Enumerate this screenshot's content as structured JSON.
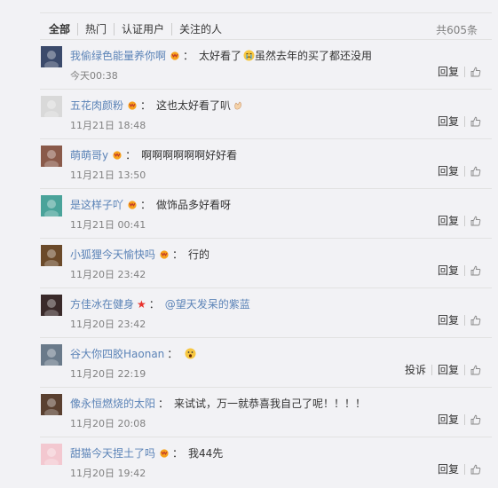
{
  "tabs": [
    {
      "label": "全部"
    },
    {
      "label": "热门"
    },
    {
      "label": "认证用户"
    },
    {
      "label": "关注的人"
    }
  ],
  "total_count": "共605条",
  "comments": [
    {
      "user": "我偷绿色能量养你啊",
      "vip": true,
      "star": false,
      "text": "太好看了",
      "emoji": "crying-face",
      "text2": "虽然去年的买了都还没用",
      "mention": "",
      "time": "今天00:38",
      "report": "",
      "reply": "回复",
      "avatar_color": "#3b4a6b"
    },
    {
      "user": "五花肉颜粉",
      "vip": true,
      "star": false,
      "text": "这也太好看了叭",
      "emoji": "clapping-hands",
      "text2": "",
      "mention": "",
      "time": "11月21日 18:48",
      "report": "",
      "reply": "回复",
      "avatar_color": "#d9d9d9"
    },
    {
      "user": "萌萌哥y",
      "vip": true,
      "star": false,
      "text": "啊啊啊啊啊啊好好看",
      "emoji": "",
      "text2": "",
      "mention": "",
      "time": "11月21日 13:50",
      "report": "",
      "reply": "回复",
      "avatar_color": "#8a5a4a"
    },
    {
      "user": "是这样子吖",
      "vip": true,
      "star": false,
      "text": "做饰品多好看呀",
      "emoji": "",
      "text2": "",
      "mention": "",
      "time": "11月21日 00:41",
      "report": "",
      "reply": "回复",
      "avatar_color": "#4aa39a"
    },
    {
      "user": "小狐狸今天愉快吗",
      "vip": true,
      "star": false,
      "text": "行的",
      "emoji": "",
      "text2": "",
      "mention": "",
      "time": "11月20日 23:42",
      "report": "",
      "reply": "回复",
      "avatar_color": "#6b4a2a"
    },
    {
      "user": "方佳冰在健身",
      "vip": false,
      "star": true,
      "text": "",
      "emoji": "",
      "text2": "",
      "mention": "@望天发呆的紫蓝",
      "time": "11月20日 23:42",
      "report": "",
      "reply": "回复",
      "avatar_color": "#3a2a2a"
    },
    {
      "user": "谷大你四胶Haonan",
      "vip": false,
      "star": false,
      "text": "",
      "emoji": "shocked-face",
      "text2": "",
      "mention": "",
      "time": "11月20日 22:19",
      "report": "投诉",
      "reply": "回复",
      "avatar_color": "#6a7a8a"
    },
    {
      "user": "像永恒燃烧的太阳",
      "vip": false,
      "star": false,
      "text": "来试试，万一就恭喜我自己了呢！！！！",
      "emoji": "",
      "text2": "",
      "mention": "",
      "time": "11月20日 20:08",
      "report": "",
      "reply": "回复",
      "avatar_color": "#5a4030"
    },
    {
      "user": "甜猫今天捏土了吗",
      "vip": true,
      "star": false,
      "text": "我44先",
      "emoji": "",
      "text2": "",
      "mention": "",
      "time": "11月20日 19:42",
      "report": "",
      "reply": "回复",
      "avatar_color": "#f3c8d0"
    }
  ]
}
